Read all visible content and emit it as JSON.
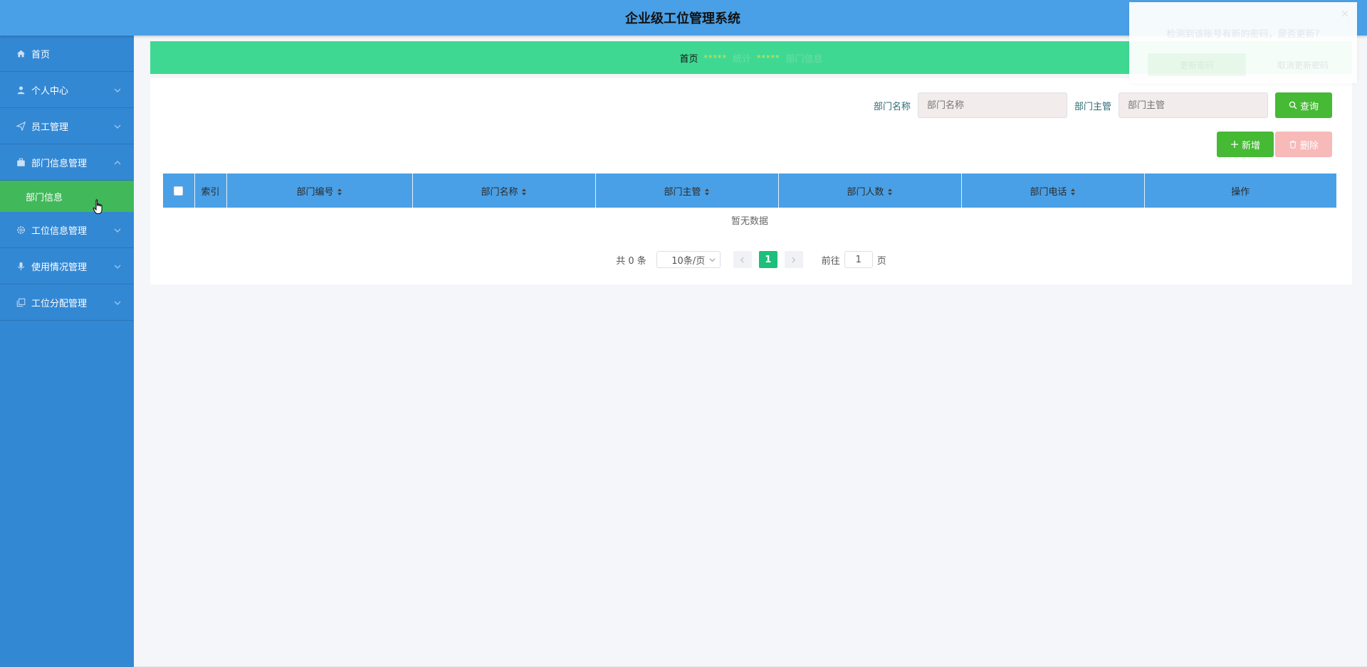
{
  "header": {
    "title": "企业级工位管理系统"
  },
  "sidebar": {
    "items": [
      {
        "label": "首页",
        "icon": "home-icon",
        "expandable": false
      },
      {
        "label": "个人中心",
        "icon": "user-icon",
        "expandable": true
      },
      {
        "label": "员工管理",
        "icon": "send-icon",
        "expandable": true
      },
      {
        "label": "部门信息管理",
        "icon": "briefcase-icon",
        "expandable": true,
        "expanded": true
      },
      {
        "label": "工位信息管理",
        "icon": "gear-icon",
        "expandable": true
      },
      {
        "label": "使用情况管理",
        "icon": "mic-icon",
        "expandable": true
      },
      {
        "label": "工位分配管理",
        "icon": "copy-icon",
        "expandable": true
      }
    ],
    "sub_items": [
      {
        "label": "部门信息",
        "active": true
      }
    ]
  },
  "breadcrumb": {
    "home": "首页",
    "separator": "*****",
    "level2": "统计",
    "level3": "部门信息"
  },
  "search": {
    "dept_name_label": "部门名称",
    "dept_name_placeholder": "部门名称",
    "dept_manager_label": "部门主管",
    "dept_manager_placeholder": "部门主管",
    "query_label": "查询"
  },
  "actions": {
    "add_label": "新增",
    "delete_label": "删除"
  },
  "table": {
    "columns": [
      "索引",
      "部门编号",
      "部门名称",
      "部门主管",
      "部门人数",
      "部门电话",
      "操作"
    ],
    "sortable": [
      false,
      true,
      true,
      true,
      true,
      true,
      false
    ],
    "empty_text": "暂无数据"
  },
  "pagination": {
    "total_text": "共 0 条",
    "page_size": "10条/页",
    "current_page": "1",
    "goto_prefix": "前往",
    "goto_value": "1",
    "goto_suffix": "页"
  },
  "notification": {
    "message": "检测到该账号有新的密码，是否更新?",
    "confirm_label": "更新密码",
    "cancel_label": "取消更新密码"
  },
  "colors": {
    "header": "#4aa0e6",
    "sidebar": "#3388d4",
    "active": "#41b85a",
    "breadcrumb": "#3fd892",
    "pager_active": "#1dbf7a"
  }
}
